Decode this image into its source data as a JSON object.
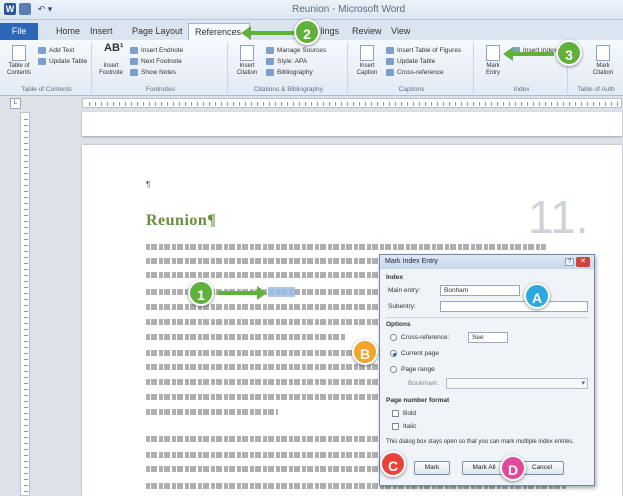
{
  "app": {
    "title": "Reunion - Microsoft Word",
    "qat": {
      "word_icon": "W",
      "undo_label": "↶ ▾"
    }
  },
  "tabs": [
    "File",
    "Home",
    "Insert",
    "Page Layout",
    "References",
    "Mailings",
    "Review",
    "View"
  ],
  "ribbon": {
    "toc": {
      "big": "Table of Contents",
      "add_text": "Add Text",
      "update": "Update Table",
      "label": "Table of Contents"
    },
    "footnotes": {
      "big": "Insert Footnote",
      "endnote": "Insert Endnote",
      "next": "Next Footnote",
      "show": "Show Notes",
      "label": "Footnotes"
    },
    "citations": {
      "big": "Insert Citation",
      "manage": "Manage Sources",
      "style_label": "Style:",
      "style_value": "APA",
      "bib": "Bibliography",
      "label": "Citations & Bibliography"
    },
    "captions": {
      "big": "Insert Caption",
      "tof": "Insert Table of Figures",
      "update": "Update Table",
      "cross": "Cross-reference",
      "label": "Captions"
    },
    "index": {
      "big": "Mark Entry",
      "insert": "Insert Index",
      "label": "Index"
    },
    "toa": {
      "big": "Mark Citation",
      "label": "Table of Auth"
    }
  },
  "document": {
    "chapter_title": "Reunion¶",
    "chapter_number": "11.",
    "pilcrow": "¶",
    "ruler_corner": "L"
  },
  "dialog": {
    "title": "Mark Index Entry",
    "help": "?",
    "close": "✕",
    "index_label": "Index",
    "main_entry_label": "Main entry:",
    "main_entry_value": "Bonham",
    "subentry_label": "Subentry:",
    "subentry_value": "",
    "options_label": "Options",
    "cross_ref_label": "Cross-reference:",
    "cross_ref_value": "See",
    "current_page_label": "Current page",
    "page_range_label": "Page range",
    "bookmark_label": "Bookmark:",
    "page_format_label": "Page number format",
    "bold_label": "Bold",
    "italic_label": "Italic",
    "note": "This dialog box stays open so that you can mark multiple index entries.",
    "mark_btn": "Mark",
    "mark_all_btn": "Mark All",
    "cancel_btn": "Cancel"
  },
  "callouts": {
    "c1": "1",
    "c2": "2",
    "c3": "3",
    "a": "A",
    "b": "B",
    "c": "C",
    "d": "D"
  },
  "colors": {
    "accent_blue": "#2b66b8",
    "chapter_green": "#6a8f3a",
    "callout_green": "#5fb13c",
    "callout_blue": "#2ea8e0",
    "callout_orange": "#f0a52a",
    "callout_red": "#e8433a",
    "callout_pink": "#e14a9a"
  }
}
